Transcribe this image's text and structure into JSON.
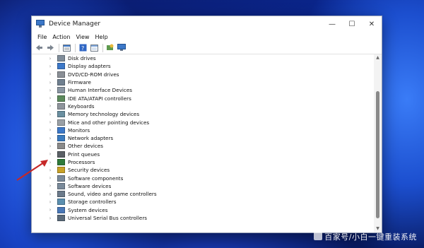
{
  "window": {
    "title": "Device Manager"
  },
  "controls": {
    "minimize": "—",
    "maximize": "☐",
    "close": "✕"
  },
  "menu": [
    "File",
    "Action",
    "View",
    "Help"
  ],
  "toolbar": [
    "back",
    "forward",
    "properties",
    "help",
    "refresh",
    "scan",
    "monitor"
  ],
  "devices": [
    {
      "label": "Disk drives",
      "icon": "disk-icon",
      "color": "#7f8c99"
    },
    {
      "label": "Display adapters",
      "icon": "display-icon",
      "color": "#3c78c8"
    },
    {
      "label": "DVD/CD-ROM drives",
      "icon": "dvd-icon",
      "color": "#8a8f96"
    },
    {
      "label": "Firmware",
      "icon": "firmware-icon",
      "color": "#6f7f8f"
    },
    {
      "label": "Human Interface Devices",
      "icon": "hid-icon",
      "color": "#8a96a3"
    },
    {
      "label": "IDE ATA/ATAPI controllers",
      "icon": "ide-icon",
      "color": "#5c8a5c"
    },
    {
      "label": "Keyboards",
      "icon": "keyboard-icon",
      "color": "#8f959c"
    },
    {
      "label": "Memory technology devices",
      "icon": "memory-icon",
      "color": "#6a8fa0"
    },
    {
      "label": "Mice and other pointing devices",
      "icon": "mouse-icon",
      "color": "#9aa0a6"
    },
    {
      "label": "Monitors",
      "icon": "monitor-icon",
      "color": "#3c78c8"
    },
    {
      "label": "Network adapters",
      "icon": "network-icon",
      "color": "#3a7bbf"
    },
    {
      "label": "Other devices",
      "icon": "other-device-icon",
      "color": "#8a8a8a"
    },
    {
      "label": "Print queues",
      "icon": "printer-icon",
      "color": "#5b6066"
    },
    {
      "label": "Processors",
      "icon": "processor-icon",
      "color": "#2f7a3a"
    },
    {
      "label": "Security devices",
      "icon": "security-icon",
      "color": "#c9a227"
    },
    {
      "label": "Software components",
      "icon": "software-component-icon",
      "color": "#7a8a9a"
    },
    {
      "label": "Software devices",
      "icon": "software-device-icon",
      "color": "#7a8a9a"
    },
    {
      "label": "Sound, video and game controllers",
      "icon": "sound-icon",
      "color": "#6b7a8a"
    },
    {
      "label": "Storage controllers",
      "icon": "storage-icon",
      "color": "#5b8fb0"
    },
    {
      "label": "System devices",
      "icon": "system-icon",
      "color": "#4a78b8"
    },
    {
      "label": "Universal Serial Bus controllers",
      "icon": "usb-icon",
      "color": "#5b6b7b"
    }
  ],
  "watermark": "百家号/小白一键重装系统",
  "colors": {
    "arrow": "#c62828",
    "accent": "#3c78c8"
  }
}
